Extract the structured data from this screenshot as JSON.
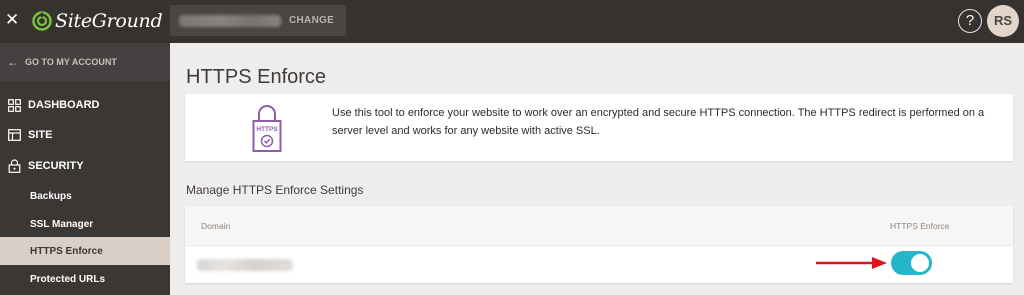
{
  "topbar": {
    "brand": "SiteGround",
    "change_label": "CHANGE",
    "avatar_initials": "RS",
    "help_glyph": "?"
  },
  "sidebar": {
    "back_label": "GO TO MY ACCOUNT",
    "items": [
      {
        "label": "DASHBOARD",
        "icon": "dashboard-grid-icon"
      },
      {
        "label": "SITE",
        "icon": "site-window-icon"
      },
      {
        "label": "SECURITY",
        "icon": "lock-icon"
      }
    ],
    "subitems": [
      {
        "label": "Backups",
        "active": false
      },
      {
        "label": "SSL Manager",
        "active": false
      },
      {
        "label": "HTTPS Enforce",
        "active": true
      },
      {
        "label": "Protected URLs",
        "active": false
      }
    ]
  },
  "main": {
    "title": "HTTPS Enforce",
    "info": {
      "icon_label": "HTTPS",
      "text": "Use this tool to enforce your website to work over an encrypted and secure HTTPS connection. The HTTPS redirect is performed on a server level and works for any website with active SSL."
    },
    "settings": {
      "title": "Manage HTTPS Enforce Settings",
      "columns": [
        "Domain",
        "HTTPS Enforce"
      ],
      "row": {
        "toggle_on": true
      }
    }
  },
  "colors": {
    "topbar": "#363230",
    "sidebar": "#3b3735",
    "active_item": "#d9cfc6",
    "toggle_on": "#25b7c9",
    "logo_green": "#7bc142",
    "lock_purple": "#8f5ea6",
    "arrow_red": "#e3101b"
  }
}
